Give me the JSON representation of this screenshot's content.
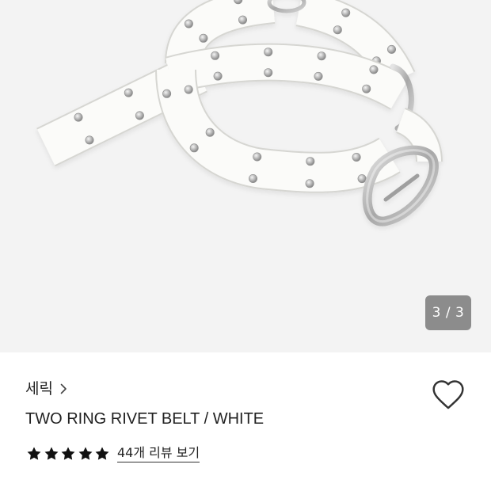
{
  "product_gallery": {
    "counter": "3 / 3"
  },
  "brand": {
    "name": "세릭",
    "icon": "chevron-right-icon"
  },
  "wishlist": {
    "icon": "heart-icon",
    "saved": false
  },
  "product": {
    "name": "TWO RING RIVET BELT / WHITE"
  },
  "rating": {
    "stars_filled": 5,
    "stars_total": 5,
    "star_icon": "star-icon",
    "review_link": "44개 리뷰 보기"
  },
  "colors": {
    "text": "#222222",
    "star": "#111111",
    "photo_background": "#f3f3f3",
    "counter_badge": "#8c8c8c",
    "counter_text": "#ffffff"
  }
}
